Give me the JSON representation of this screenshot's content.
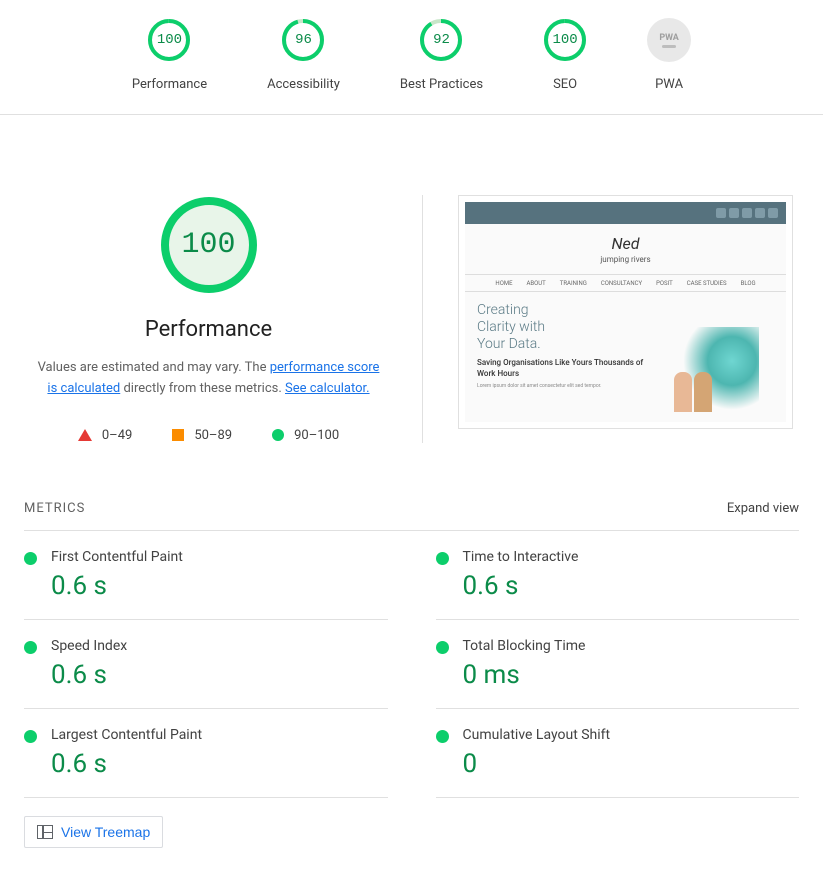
{
  "nav": [
    {
      "label": "Performance",
      "score": 100,
      "status": "green"
    },
    {
      "label": "Accessibility",
      "score": 96,
      "status": "green"
    },
    {
      "label": "Best Practices",
      "score": 92,
      "status": "green"
    },
    {
      "label": "SEO",
      "score": 100,
      "status": "green"
    },
    {
      "label": "PWA",
      "score": null,
      "status": "na"
    }
  ],
  "hero": {
    "score": 100,
    "title": "Performance",
    "desc_prefix": "Values are estimated and may vary. The ",
    "desc_link1": "performance score is calculated",
    "desc_mid": " directly from these metrics. ",
    "desc_link2": "See calculator."
  },
  "legend": {
    "fail": "0–49",
    "avg": "50–89",
    "pass": "90–100"
  },
  "screenshot": {
    "brand": "jumping rivers",
    "nav": [
      "HOME",
      "ABOUT",
      "TRAINING",
      "CONSULTANCY",
      "POSIT",
      "CASE STUDIES",
      "BLOG"
    ],
    "h1_l1": "Creating",
    "h1_l2": "Clarity with",
    "h1_l3": "Your Data.",
    "h2": "Saving Organisations Like Yours Thousands of Work Hours"
  },
  "metrics": {
    "section_title": "METRICS",
    "expand": "Expand view",
    "items": [
      {
        "name": "First Contentful Paint",
        "value": "0.6 s"
      },
      {
        "name": "Time to Interactive",
        "value": "0.6 s"
      },
      {
        "name": "Speed Index",
        "value": "0.6 s"
      },
      {
        "name": "Total Blocking Time",
        "value": "0 ms"
      },
      {
        "name": "Largest Contentful Paint",
        "value": "0.6 s"
      },
      {
        "name": "Cumulative Layout Shift",
        "value": "0"
      }
    ]
  },
  "treemap_label": "View Treemap"
}
